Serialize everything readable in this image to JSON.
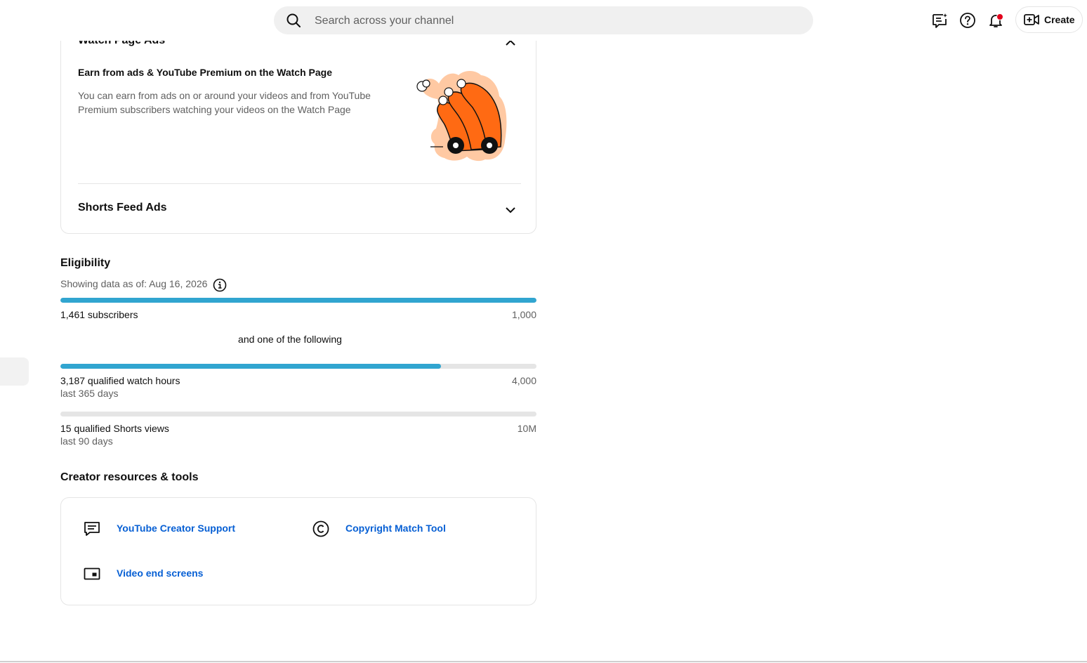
{
  "search": {
    "placeholder": "Search across your channel"
  },
  "header": {
    "create_label": "Create"
  },
  "icons": {
    "search": "search-icon",
    "feedback": "feedback-icon",
    "help": "help-icon",
    "notifications": "bell-icon",
    "create": "video-plus-icon",
    "info": "info-icon",
    "support": "chat-icon",
    "copyright": "copyright-icon",
    "endscreens": "end-screen-icon"
  },
  "colors": {
    "progress_fill": "#31a5d0",
    "progress_track": "#e5e5e5",
    "link": "#065fd4",
    "notification_dot": "#e3001b",
    "illustration_orange": "#ff6a13",
    "illustration_peach": "#ffc9a3"
  },
  "ads": {
    "previous_section_title": "Watch Page Ads",
    "watch_heading": "Earn from ads & YouTube Premium on the Watch Page",
    "watch_description": "You can earn from ads on or around your videos and from YouTube Premium subscribers watching your videos on the Watch Page",
    "shorts_title": "Shorts Feed Ads"
  },
  "eligibility": {
    "title": "Eligibility",
    "as_of": "Showing data as of: Aug 16, 2026",
    "connector": "and one of the following",
    "metrics": [
      {
        "label": "1,461 subscribers",
        "target": "1,000",
        "period": "",
        "progress": 1.0
      },
      {
        "label": "3,187 qualified watch hours",
        "target": "4,000",
        "period": "last 365 days",
        "progress": 0.8
      },
      {
        "label": "15 qualified Shorts views",
        "target": "10M",
        "period": "last 90 days",
        "progress": 0.0
      }
    ]
  },
  "resources": {
    "title": "Creator resources & tools",
    "links": [
      {
        "label": "YouTube Creator Support"
      },
      {
        "label": "Copyright Match Tool"
      },
      {
        "label": "Video end screens"
      }
    ]
  }
}
